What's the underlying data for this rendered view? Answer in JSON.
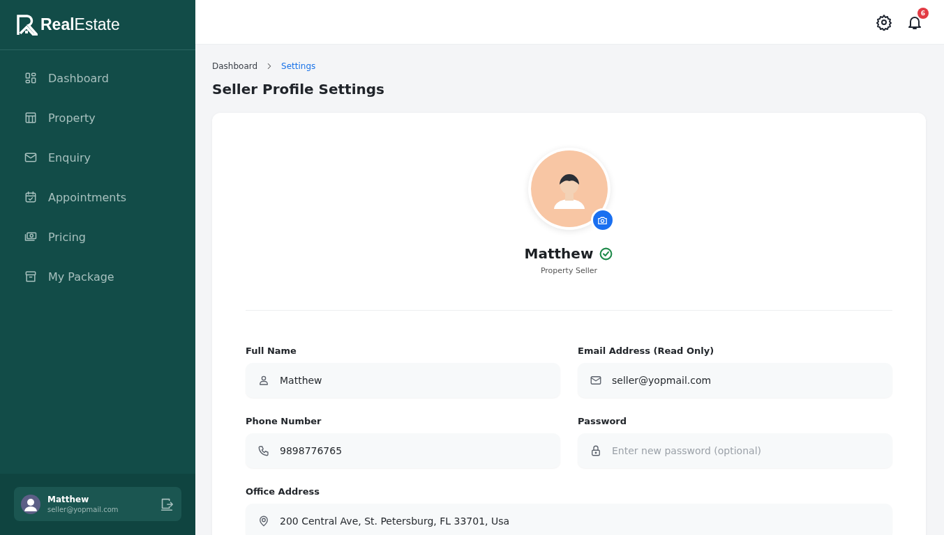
{
  "brand": {
    "bold": "Real",
    "light": "Estate"
  },
  "sidebar": {
    "items": [
      {
        "label": "Dashboard",
        "selected": false
      },
      {
        "label": "Property",
        "selected": false
      },
      {
        "label": "Enquiry",
        "selected": false
      },
      {
        "label": "Appointments",
        "selected": false
      },
      {
        "label": "Pricing",
        "selected": false
      },
      {
        "label": "My Package",
        "selected": false
      }
    ],
    "user": {
      "name": "Matthew",
      "email": "seller@yopmail.com"
    }
  },
  "topbar": {
    "notification_count": "6"
  },
  "breadcrumb": [
    {
      "label": "Dashboard",
      "selected": false
    },
    {
      "label": "Settings",
      "selected": true
    }
  ],
  "page_title": "Seller Profile Settings",
  "profile": {
    "name": "Matthew",
    "verified": true,
    "role": "Property Seller"
  },
  "fields": [
    {
      "label": "Full Name",
      "kind": "half",
      "value": "Matthew"
    },
    {
      "label": "Email Address (Read Only)",
      "kind": "half",
      "value": "seller@yopmail.com"
    },
    {
      "label": "Phone Number",
      "kind": "half",
      "value": "9898776765"
    },
    {
      "label": "Password",
      "kind": "half",
      "placeholder": "Enter new password (optional)"
    },
    {
      "label": "Office Address",
      "kind": "wide",
      "value": "200 Central Ave, St. Petersburg, FL 33701, Usa"
    }
  ]
}
